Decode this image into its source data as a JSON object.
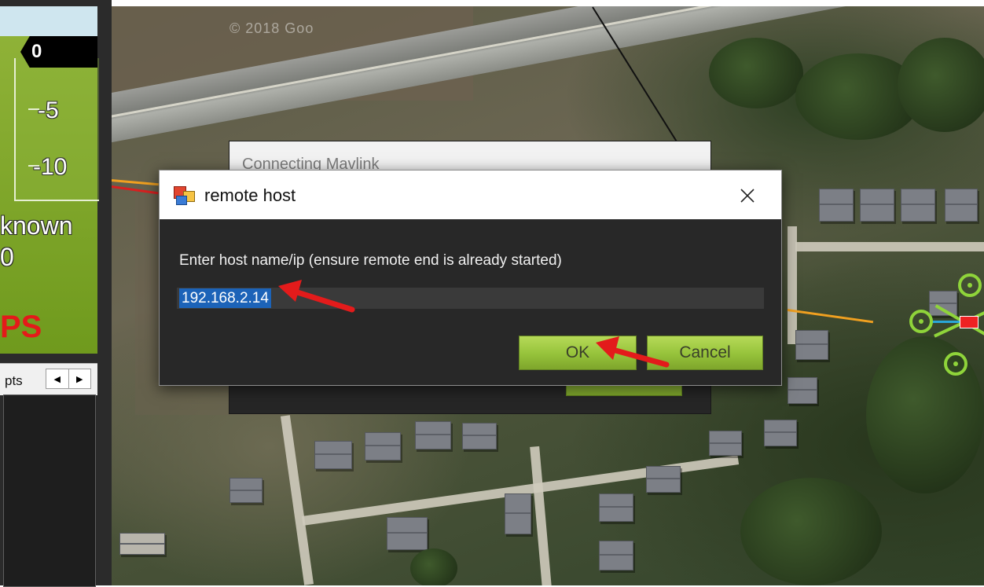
{
  "map": {
    "watermark": "© 2018 Goo"
  },
  "hud": {
    "altitude_value": "0",
    "tape_labels": [
      "-5",
      "-10"
    ],
    "status_line_1": "known",
    "status_line_2": "0",
    "gps_text": "PS",
    "tab_label": "pts"
  },
  "connecting_dialog": {
    "title": "Connecting Mavlink"
  },
  "remote_host_dialog": {
    "title": "remote host",
    "prompt": "Enter host name/ip (ensure remote end is already started)",
    "host_value": "192.168.2.14",
    "ok_label": "OK",
    "cancel_label": "Cancel"
  },
  "colors": {
    "button_green": "#95c23a",
    "selection_blue": "#1c63b8",
    "hud_green": "#7fa628",
    "annotation_red": "#e31b1b",
    "drone_green": "#8fd43a"
  },
  "icons": {
    "close": "close-icon",
    "app": "mission-planner-icon",
    "scroll_left": "chevron-left-icon",
    "scroll_right": "chevron-right-icon"
  }
}
